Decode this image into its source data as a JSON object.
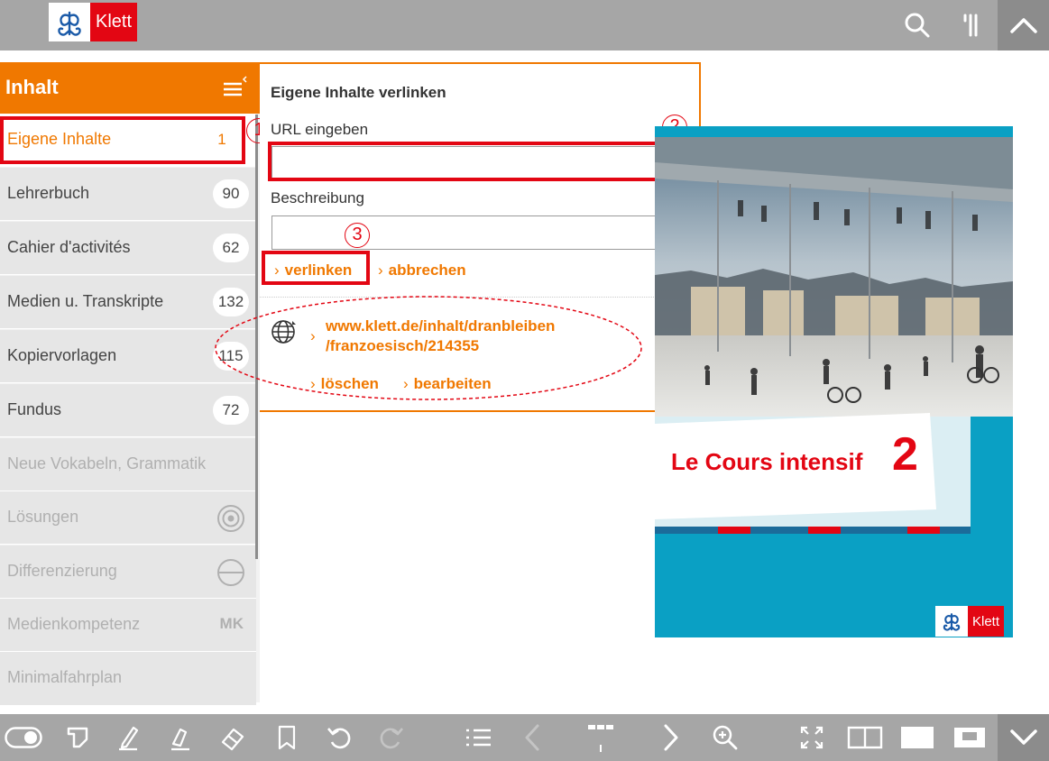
{
  "header": {
    "logo_text": "Klett"
  },
  "sidebar": {
    "title": "Inhalt",
    "items": [
      {
        "label": "Eigene Inhalte",
        "badge": "1"
      },
      {
        "label": "Lehrerbuch",
        "badge": "90"
      },
      {
        "label": "Cahier d'activités",
        "badge": "62"
      },
      {
        "label": "Medien u. Transkripte",
        "badge": "132"
      },
      {
        "label": "Kopiervorlagen",
        "badge": "115"
      },
      {
        "label": "Fundus",
        "badge": "72"
      },
      {
        "label": "Neue Vokabeln, Grammatik"
      },
      {
        "label": "Lösungen"
      },
      {
        "label": "Differenzierung"
      },
      {
        "label": "Medienkompetenz",
        "tag": "MK"
      },
      {
        "label": "Minimalfahrplan"
      }
    ]
  },
  "annotations": {
    "n1": "1",
    "n2": "2",
    "n3": "3"
  },
  "panel": {
    "title": "Eigene Inhalte verlinken",
    "url_label": "URL eingeben",
    "url_value": "",
    "desc_label": "Beschreibung",
    "desc_value": "",
    "link_button": "verlinken",
    "cancel_button": "abbrechen",
    "saved_link_line1": "www.klett.de/inhalt/dranbleiben",
    "saved_link_line2": "/franzoesisch/214355",
    "delete_button": "löschen",
    "edit_button": "bearbeiten"
  },
  "book": {
    "title": "Le Cours intensif",
    "number": "2",
    "publisher": "Klett"
  },
  "colors": {
    "accent": "#f07800",
    "annotation": "#e30613",
    "toolbar": "#a6a6a6",
    "cover": "#0aa0c4"
  },
  "icons": {
    "top": [
      "search-icon",
      "columns-icon",
      "chevron-up-icon"
    ],
    "bottom": [
      "toggle-icon",
      "note-icon",
      "pencil-icon",
      "marker-icon",
      "eraser-icon",
      "bookmark-icon",
      "undo-icon",
      "redo-icon",
      "list-icon",
      "prev-page-icon",
      "page-slider-icon",
      "next-page-icon",
      "zoom-in-icon",
      "fullscreen-icon",
      "double-page-icon",
      "single-page-icon",
      "page-view-icon",
      "chevron-down-icon"
    ]
  }
}
